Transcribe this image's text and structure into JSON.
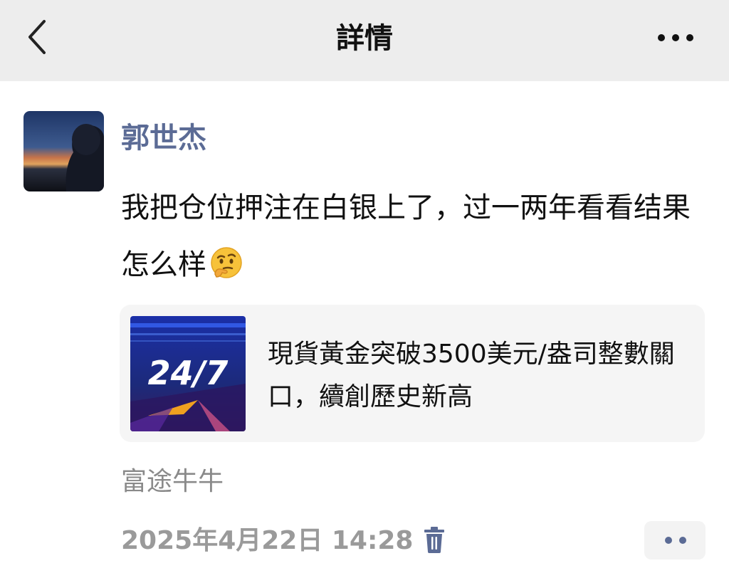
{
  "header": {
    "title": "詳情",
    "back_icon": "chevron-left-icon",
    "more_icon": "more-horizontal-icon"
  },
  "post": {
    "author": "郭世杰",
    "text": "我把仓位押注在白银上了，过一两年看看结果怎么样",
    "emoji": "thinking-face-emoji",
    "link_card": {
      "thumbnail_text": "24/7",
      "title": "現貨黃金突破3500美元/盎司整數關口，續創歷史新高"
    },
    "source": "富途牛牛",
    "timestamp": "2025年4月22日 14:28",
    "delete_icon": "trash-icon",
    "comment_icon": "more-dots-icon"
  },
  "colors": {
    "header_bg": "#ededed",
    "author_name": "#5b6b95",
    "action_icon": "#5b6b95",
    "card_bg": "#f5f5f5",
    "meta_text": "#8a8a8a"
  }
}
